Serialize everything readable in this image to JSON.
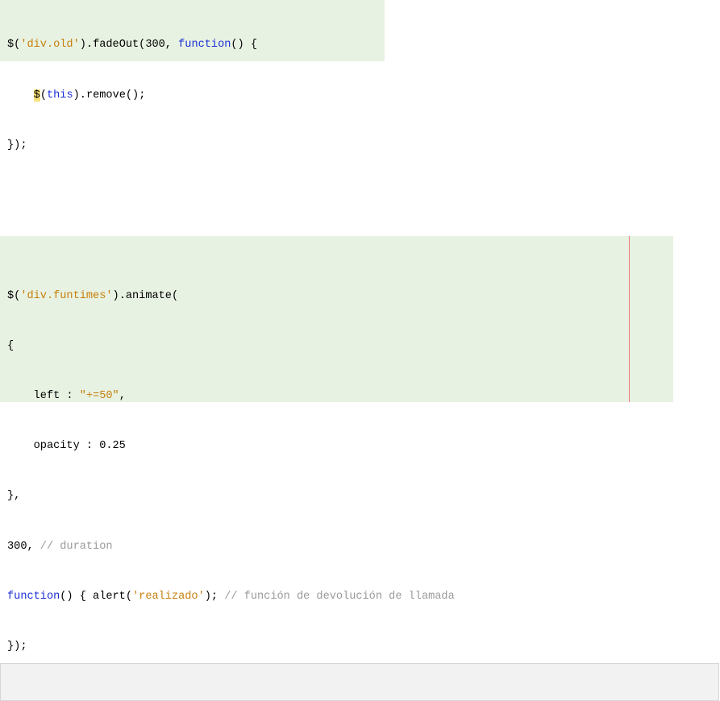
{
  "code_block_1": {
    "line1": {
      "t1": "$(",
      "t2": "'div.old'",
      "t3": ").fadeOut(300, ",
      "t4": "function",
      "t5": "() {"
    },
    "line2": {
      "indent": "    ",
      "t1": "$",
      "t2": "(",
      "t3": "this",
      "t4": ").remove();"
    },
    "line3": {
      "t1": "});"
    }
  },
  "code_block_2": {
    "line1": {
      "t1": "$(",
      "t2": "'div.funtimes'",
      "t3": ").animate("
    },
    "line2": {
      "t1": "{"
    },
    "line3": {
      "t1": "    left : ",
      "t2": "\"+=50\"",
      "t3": ","
    },
    "line4": {
      "t1": "    opacity : 0.25"
    },
    "line5": {
      "t1": "},"
    },
    "line6": {
      "t1": "300, ",
      "t2": "// duration"
    },
    "line7": {
      "t1": "function",
      "t2": "() { alert(",
      "t3": "'realizado'",
      "t4": "); ",
      "t5": "// función de devolución de llamada"
    },
    "line8": {
      "t1": "});"
    }
  },
  "colors": {
    "code_background": "#e8f2e2",
    "string": "#c6800e",
    "keyword": "#1b2fd8",
    "comment": "#9a9a9a",
    "highlight": "#f7e27a",
    "margin_guide": "#f07a7a"
  }
}
